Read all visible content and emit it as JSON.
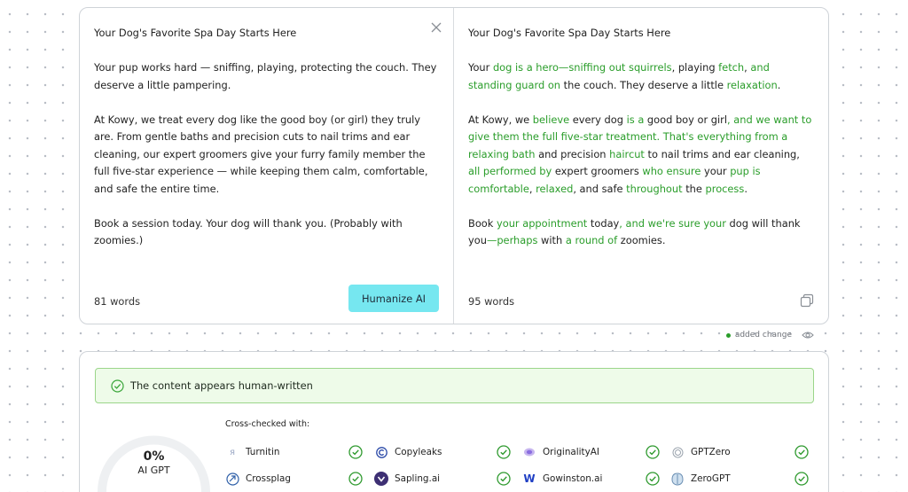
{
  "editor": {
    "input": {
      "title": "Your Dog's Favorite Spa Day Starts Here",
      "p1": "Your pup works hard — sniffing, playing, protecting the couch. They deserve a little pampering.",
      "p2": "At Kowy, we treat every dog like the good boy (or girl) they truly are. From gentle baths and precision cuts to nail trims and ear cleaning, our expert groomers give your furry family member the full five-star experience — while keeping them calm, comfortable, and safe the entire time.",
      "p3": "Book a session today. Your dog will thank you. (Probably with zoomies.)",
      "word_count": "81 words",
      "humanize_label": "Humanize AI"
    },
    "output": {
      "title": "Your Dog's Favorite Spa Day Starts Here",
      "paragraphs": [
        [
          {
            "t": "Your ",
            "c": false
          },
          {
            "t": "dog is a hero—sniffing out squirrels",
            "c": true
          },
          {
            "t": ", playing ",
            "c": false
          },
          {
            "t": "fetch",
            "c": true
          },
          {
            "t": ", ",
            "c": false
          },
          {
            "t": "and standing guard on",
            "c": true
          },
          {
            "t": " the couch. They deserve a little ",
            "c": false
          },
          {
            "t": "relaxation",
            "c": true
          },
          {
            "t": ".",
            "c": false
          }
        ],
        [
          {
            "t": "At Kowy, we ",
            "c": false
          },
          {
            "t": "believe",
            "c": true
          },
          {
            "t": " every dog ",
            "c": false
          },
          {
            "t": "is a",
            "c": true
          },
          {
            "t": " good boy or girl",
            "c": false
          },
          {
            "t": ", and we want to give them the full five-star treatment. That's everything from a relaxing bath",
            "c": true
          },
          {
            "t": " and precision ",
            "c": false
          },
          {
            "t": "haircut",
            "c": true
          },
          {
            "t": " to nail trims and ear cleaning, ",
            "c": false
          },
          {
            "t": "all performed by",
            "c": true
          },
          {
            "t": " expert groomers ",
            "c": false
          },
          {
            "t": "who ensure",
            "c": true
          },
          {
            "t": " your ",
            "c": false
          },
          {
            "t": "pup is comfortable",
            "c": true
          },
          {
            "t": ", ",
            "c": false
          },
          {
            "t": "relaxed",
            "c": true
          },
          {
            "t": ", and safe ",
            "c": false
          },
          {
            "t": "throughout",
            "c": true
          },
          {
            "t": " the ",
            "c": false
          },
          {
            "t": "process",
            "c": true
          },
          {
            "t": ".",
            "c": false
          }
        ],
        [
          {
            "t": "Book ",
            "c": false
          },
          {
            "t": "your appointment",
            "c": true
          },
          {
            "t": " today",
            "c": false
          },
          {
            "t": ", and we're sure your",
            "c": true
          },
          {
            "t": " dog will thank you",
            "c": false
          },
          {
            "t": "—perhaps",
            "c": true
          },
          {
            "t": " with ",
            "c": false
          },
          {
            "t": "a round of",
            "c": true
          },
          {
            "t": " zoomies.",
            "c": false
          }
        ]
      ],
      "word_count": "95 words"
    }
  },
  "legend": {
    "label": "added change",
    "color": "#2a9d2a"
  },
  "results": {
    "banner": "The content appears human-written",
    "cross_checked_label": "Cross-checked with:",
    "gauge_value": "0%",
    "gauge_label": "AI GPT",
    "gauge_fraction": 0,
    "checkers": [
      {
        "name": "Turnitin",
        "icon": "turnitin-icon",
        "passed": true
      },
      {
        "name": "Copyleaks",
        "icon": "copyleaks-icon",
        "passed": true
      },
      {
        "name": "OriginalityAI",
        "icon": "originality-icon",
        "passed": true
      },
      {
        "name": "GPTZero",
        "icon": "gptzero-icon",
        "passed": true
      },
      {
        "name": "Crossplag",
        "icon": "crossplag-icon",
        "passed": true
      },
      {
        "name": "Sapling.ai",
        "icon": "sapling-icon",
        "passed": true
      },
      {
        "name": "Gowinston.ai",
        "icon": "winston-icon",
        "passed": true
      },
      {
        "name": "ZeroGPT",
        "icon": "zerogpt-icon",
        "passed": true
      }
    ]
  }
}
